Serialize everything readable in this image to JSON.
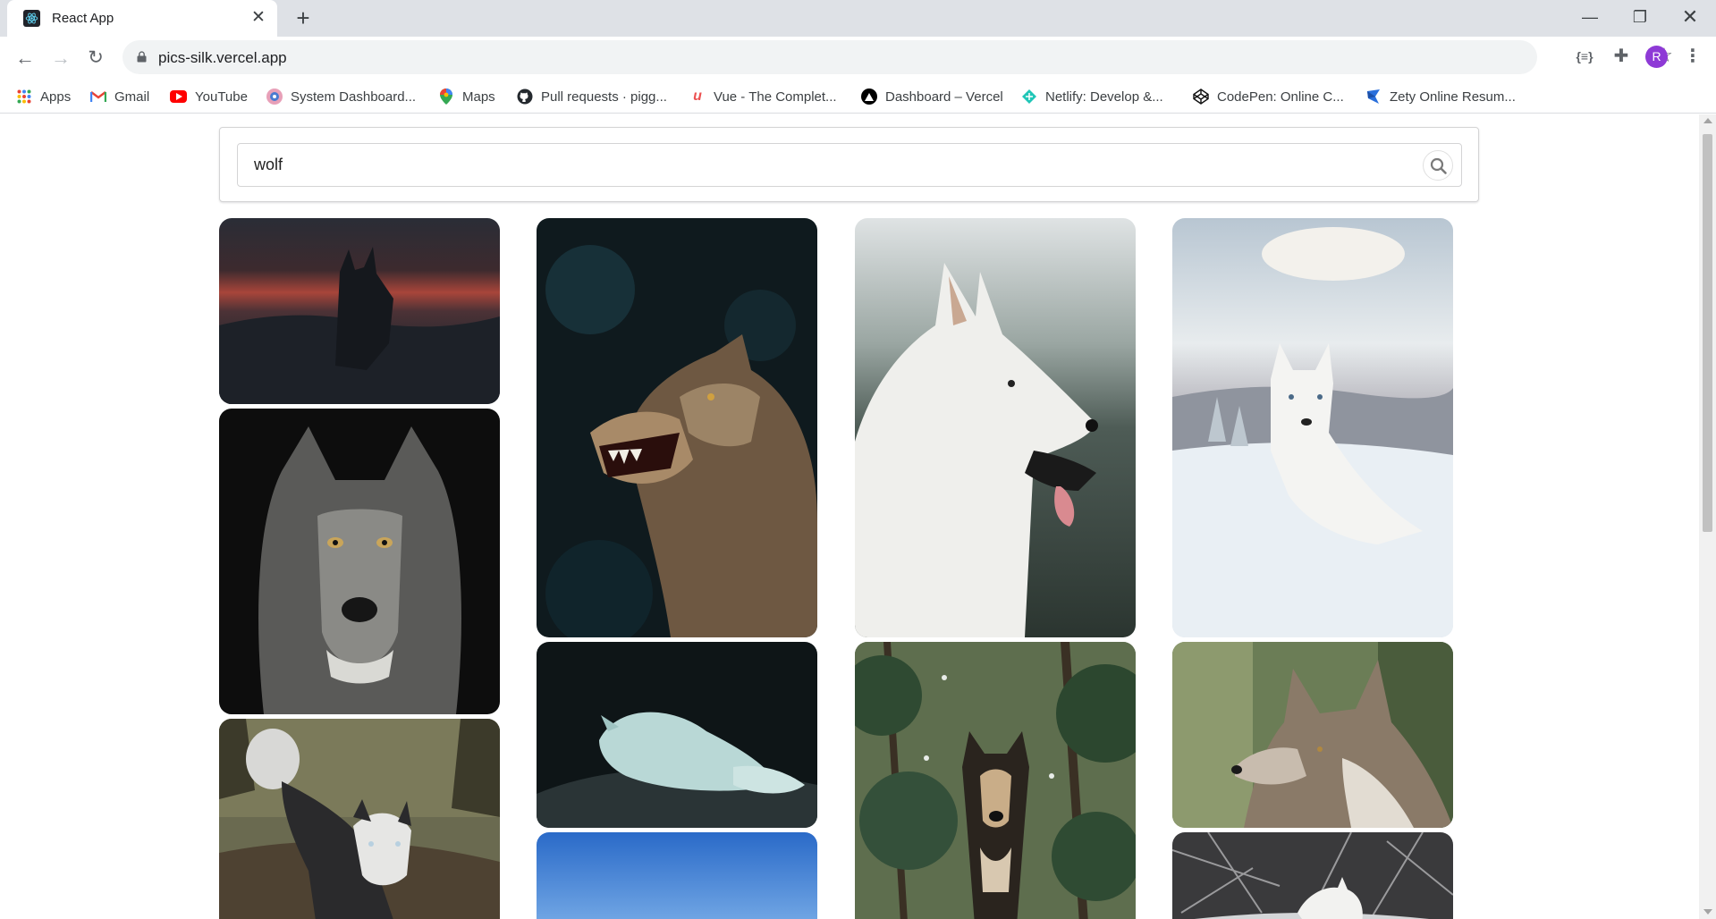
{
  "browser": {
    "tab_title": "React App",
    "url": "pics-silk.vercel.app",
    "avatar_letter": "R"
  },
  "bookmarks": [
    {
      "label": "Apps",
      "icon": "apps-grid-icon"
    },
    {
      "label": "Gmail",
      "icon": "gmail-icon"
    },
    {
      "label": "YouTube",
      "icon": "youtube-icon"
    },
    {
      "label": "System Dashboard...",
      "icon": "dashboard-icon"
    },
    {
      "label": "Maps",
      "icon": "maps-pin-icon"
    },
    {
      "label": "Pull requests · pigg...",
      "icon": "github-icon"
    },
    {
      "label": "Vue - The Complet...",
      "icon": "udemy-icon"
    },
    {
      "label": "Dashboard – Vercel",
      "icon": "vercel-icon"
    },
    {
      "label": "Netlify: Develop &...",
      "icon": "netlify-icon"
    },
    {
      "label": "CodePen: Online C...",
      "icon": "codepen-icon"
    },
    {
      "label": "Zety Online Resum...",
      "icon": "zety-icon"
    }
  ],
  "search": {
    "value": "wolf",
    "icon": "search-icon"
  },
  "images": [
    {
      "subject": "wolf silhouette at red sunset"
    },
    {
      "subject": "grey wolf face portrait"
    },
    {
      "subject": "husky walking on forest path"
    },
    {
      "subject": "snarling wolf in dark forest"
    },
    {
      "subject": "white arctic fox sleeping on rock"
    },
    {
      "subject": "blue sky"
    },
    {
      "subject": "white wolf profile with tongue out"
    },
    {
      "subject": "wolfdog standing in pine forest"
    },
    {
      "subject": "white husky lying in snow"
    },
    {
      "subject": "grey wolf profile in green forest"
    },
    {
      "subject": "white wolf in snowy branches"
    }
  ],
  "colors": {
    "tabstrip": "#dee1e6",
    "avatar": "#8e3ad6",
    "omnibox": "#f1f3f4"
  }
}
